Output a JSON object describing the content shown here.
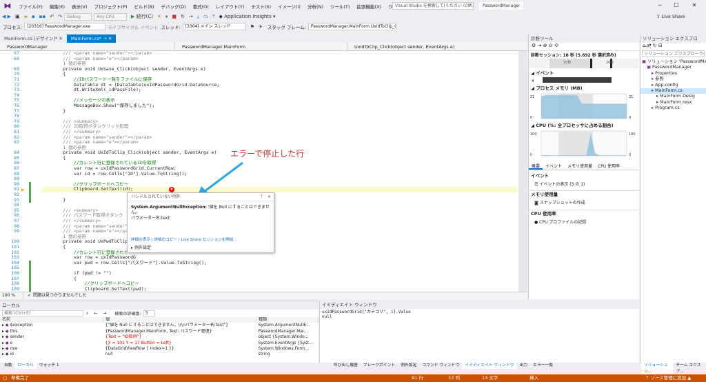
{
  "menubar": {
    "items": [
      "ファイル(F)",
      "編集(E)",
      "表示(V)",
      "プロジェクト(P)",
      "ビルド(B)",
      "デバッグ(D)",
      "書式(O)",
      "レイアウト(Y)",
      "テスト(S)",
      "イメージ(I)",
      "分析(N)",
      "ツール(T)",
      "拡張機能(X)",
      "ウィンドウ(W)",
      "ヘルプ(H)"
    ],
    "search_placeholder": "Visual Studio を検索して(ください (Ctrl...",
    "solution_title": "PasswordManager"
  },
  "toolbar1": {
    "debug_combo": "Debug",
    "cpu_combo": "Any CPU",
    "continue_label": "続行(C)",
    "app_insights": "Application Insights",
    "live_share": "Live Share"
  },
  "toolbar2": {
    "process_label": "プロセス:",
    "process_value": "[20316] PasswordManager.exe",
    "lifecycle_label": "ライフサイクル イベント",
    "thread_label": "スレッド:",
    "thread_value": "[3304] メイン スレッド",
    "stackframe_label": "スタック フレーム:",
    "stackframe_value": "PasswordManager.MainForm.UxIdToClip_C"
  },
  "doctabs": [
    "MainForm.cs [デザイン]*",
    "MainForm.cs*"
  ],
  "navbar": {
    "project": "PasswordManager",
    "class": "PasswordManager.MainForm",
    "member": "UxIdToClip_Click(object sender, EventArgs e)"
  },
  "editor": {
    "lines": [
      {
        "n": "67",
        "t": "        /// <param name=\"sender\"></param>",
        "c": "gray"
      },
      {
        "n": "68",
        "t": "        /// <param name=\"e\"></param>",
        "c": "gray"
      },
      {
        "n": "",
        "t": "        1 個の参照",
        "c": "gray"
      },
      {
        "n": "69",
        "t": "        private void UxSave_Click(object sender, EventArgs e)",
        "c": "code"
      },
      {
        "n": "70",
        "t": "        {",
        "c": "code"
      },
      {
        "n": "71",
        "t": "            //IDパスワード一覧をファイルに保存",
        "c": "green"
      },
      {
        "n": "72",
        "t": "            DataTable dt = (DataTable)uxIdPasswordGrid.DataSource;",
        "c": "code"
      },
      {
        "n": "73",
        "t": "            dt.WriteXml(_idPassFile);",
        "c": "code"
      },
      {
        "n": "74",
        "t": "",
        "c": "code"
      },
      {
        "n": "75",
        "t": "            //メッセージの表示",
        "c": "green"
      },
      {
        "n": "76",
        "t": "            MessageBox.Show(\"保存しました\");",
        "c": "code"
      },
      {
        "n": "77",
        "t": "        }",
        "c": "code"
      },
      {
        "n": "78",
        "t": "",
        "c": "code"
      },
      {
        "n": "79",
        "t": "        /// <summary>",
        "c": "gray"
      },
      {
        "n": "80",
        "t": "        /// ID取得ボタンクリック処理",
        "c": "green"
      },
      {
        "n": "81",
        "t": "        /// </summary>",
        "c": "gray"
      },
      {
        "n": "82",
        "t": "        /// <param name=\"sender\"></param>",
        "c": "gray"
      },
      {
        "n": "83",
        "t": "        /// <param name=\"e\"></param>",
        "c": "gray"
      },
      {
        "n": "",
        "t": "        1 個の参照",
        "c": "gray"
      },
      {
        "n": "84",
        "t": "        private void UxIdToClip_Click(object sender, EventArgs e)",
        "c": "code"
      },
      {
        "n": "85",
        "t": "        {",
        "c": "code"
      },
      {
        "n": "86",
        "t": "            //カレント行に登録されているIDを取得",
        "c": "green"
      },
      {
        "n": "87",
        "t": "            var row = uxIdPasswordGrid.CurrentRow;",
        "c": "code"
      },
      {
        "n": "88",
        "t": "            var id = row.Cells[\"ID\"].Value.ToString();",
        "c": "code"
      },
      {
        "n": "89",
        "t": "",
        "c": "code"
      },
      {
        "n": "90",
        "t": "            //クリップボードへコピー",
        "c": "green"
      },
      {
        "n": "91",
        "t": "            Clipboard.SetText(id);",
        "c": "hl"
      },
      {
        "n": "92",
        "t": "",
        "c": "code"
      },
      {
        "n": "93",
        "t": "        }",
        "c": "code"
      },
      {
        "n": "94",
        "t": "",
        "c": "code"
      },
      {
        "n": "95",
        "t": "        /// <summary>",
        "c": "gray"
      },
      {
        "n": "96",
        "t": "        /// パスワード取得ボタンク",
        "c": "green"
      },
      {
        "n": "97",
        "t": "        /// </summary>",
        "c": "gray"
      },
      {
        "n": "98",
        "t": "        /// <param name=\"sender\"></param>",
        "c": "gray"
      },
      {
        "n": "99",
        "t": "        /// <param name=\"e\"></param>",
        "c": "gray"
      },
      {
        "n": "",
        "t": "        1 個の参照",
        "c": "gray"
      },
      {
        "n": "100",
        "t": "        private void UxPwdToClip_C",
        "c": "code"
      },
      {
        "n": "101",
        "t": "        {",
        "c": "code"
      },
      {
        "n": "102",
        "t": "            //カレント行に登録されて",
        "c": "green"
      },
      {
        "n": "103",
        "t": "            var row = uxIdPasswordG",
        "c": "code"
      },
      {
        "n": "104",
        "t": "            var pwd = row.Cells[\"パスワード\"].Value.ToString();",
        "c": "code"
      },
      {
        "n": "105",
        "t": "",
        "c": "code"
      },
      {
        "n": "106",
        "t": "            if (pwd != \"\")",
        "c": "code"
      },
      {
        "n": "107",
        "t": "            {",
        "c": "code"
      },
      {
        "n": "108",
        "t": "                //クリップボードへコピー",
        "c": "green"
      },
      {
        "n": "109",
        "t": "                Clipboard.SetText(pwd);",
        "c": "code"
      },
      {
        "n": "110",
        "t": "            }",
        "c": "code"
      },
      {
        "n": "111",
        "t": "        }",
        "c": "code"
      }
    ],
    "zoom": "100 %",
    "status": "問題は見つかりませんでした"
  },
  "exception": {
    "header": "ハンドルされていない例外",
    "type": "System.ArgumentNullException:",
    "message": "'値を Null にすることはできません。",
    "param": "パラメーター名:text'",
    "link1": "詳細の表示",
    "link2": "詳細のコピー",
    "link3": "Live Share セッションを開始...",
    "settings": "例外設定"
  },
  "annotation": "エラーで停止した行",
  "diag": {
    "title": "診断ツール",
    "session": "診断セッション: 18 秒 (5.692 秒 選択済み)",
    "tick1": "10秒",
    "tick2": "20秒",
    "events": "イベント",
    "process_memory": "プロセス メモリ (MB)",
    "mem_max": "21",
    "mem_min": "0",
    "cpu": "CPU (%: 全プロセッサに占める割合)",
    "cpu_max": "100",
    "cpu_min": "0",
    "tabs": [
      "概要",
      "イベント",
      "メモリ使用量",
      "CPU 使用率"
    ],
    "ev_section": "イベント",
    "ev_show": "イベントの表示 (3 の 1)",
    "mem_section": "メモリ使用量",
    "snapshot": "スナップショットの作成",
    "cpu_section": "CPU 使用率",
    "cpu_profile": "CPU プロファイルの記録",
    "mem_values": [
      0.9,
      0.95,
      0.95,
      0.95,
      0.95,
      0.95,
      0.95,
      0.95,
      0.95,
      0.6,
      0.6,
      0.6,
      0.6,
      0.6,
      0.6,
      0.6,
      0.6,
      0.6,
      0.6,
      0.6
    ],
    "cpu_values": [
      0.02,
      0.03,
      0.02,
      0.02,
      0.02,
      0.03,
      0.02,
      0.02,
      0.02,
      0.02,
      0.02,
      0.9,
      0.1,
      0.02,
      0.02,
      0.02,
      0.02,
      0.02,
      0.02,
      0.02
    ]
  },
  "solution": {
    "title": "ソリューション エクスプロー...",
    "search": "ソリューション エクスプローラー...",
    "items": [
      {
        "label": "ソリューション 'PasswordMan",
        "indent": 0
      },
      {
        "label": "PasswordManager",
        "indent": 1
      },
      {
        "label": "Properties",
        "indent": 2
      },
      {
        "label": "参照",
        "indent": 2
      },
      {
        "label": "App.config",
        "indent": 2
      },
      {
        "label": "MainForm.cs",
        "indent": 2
      },
      {
        "label": "MainForm.Desig",
        "indent": 3
      },
      {
        "label": "MainForm.resx",
        "indent": 3
      },
      {
        "label": "Program.cs",
        "indent": 2
      }
    ]
  },
  "locals": {
    "title": "ローカル",
    "search_placeholder": "検索 (Ctrl+E)",
    "depth_label": "検索の詳細度:",
    "depth_value": "3",
    "headers": [
      "名前",
      "値",
      "種類"
    ],
    "rows": [
      {
        "name": "$exception",
        "value": "{\"値を Null にすることはできません。\\r\\nパラメーター名:text\"}",
        "type": "System.ArgumentNullE..."
      },
      {
        "name": "this",
        "value": "{PasswordManager.MainForm, Text: パスワード管理}",
        "type": "PasswordManager.Mai..."
      },
      {
        "name": "sender",
        "value": "{Text = \"ID取得\"}",
        "type": "object {System.Windo..."
      },
      {
        "name": "e",
        "value": "{X = 101 Y = 17 Button = Left}",
        "type": "System.EventArgs {Syst..."
      },
      {
        "name": "row",
        "value": "{DataGridViewRow { Index=1 }}",
        "type": "System.Windows.Form..."
      },
      {
        "name": "id",
        "value": "null",
        "type": "string"
      }
    ],
    "tabs": [
      "自動",
      "ローカル",
      "ウォッチ 1"
    ]
  },
  "immediate": {
    "title": "イミディエイト ウィンドウ",
    "lines": [
      "uxIdPasswordGrid[\"カテゴリ\", 1].Value",
      "null"
    ],
    "tabs": [
      "呼び出し履歴",
      "ブレークポイント",
      "例外設定",
      "コマンド ウィンドウ",
      "イミディエイト ウィンドウ",
      "出力",
      "エラー一覧"
    ]
  },
  "solution_tabs": [
    "ソリューション...",
    "チーム エクスプ..."
  ],
  "status": {
    "ready": "準備完了",
    "line": "91 行",
    "col": "13 列",
    "char": "13 文字",
    "ins": "挿入",
    "source": "↑ ソース管理に追加 ▲"
  }
}
